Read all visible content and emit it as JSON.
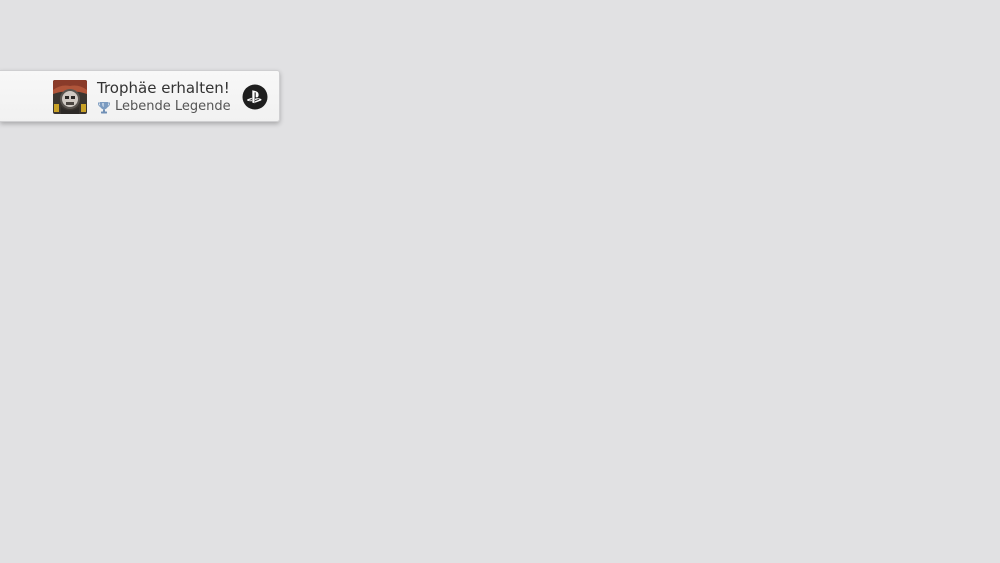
{
  "notification": {
    "title": "Trophäe erhalten!",
    "trophy_name": "Lebende Legende",
    "trophy_grade_icon": "platinum-trophy-icon",
    "platform_icon": "playstation-logo-icon",
    "colors": {
      "background": "#e1e1e3",
      "toast": "#f5f5f5",
      "title_text": "#333333",
      "subtitle_text": "#555555",
      "trophy_icon": "#6f8fb5",
      "logo_circle": "#1e1e1e"
    }
  }
}
